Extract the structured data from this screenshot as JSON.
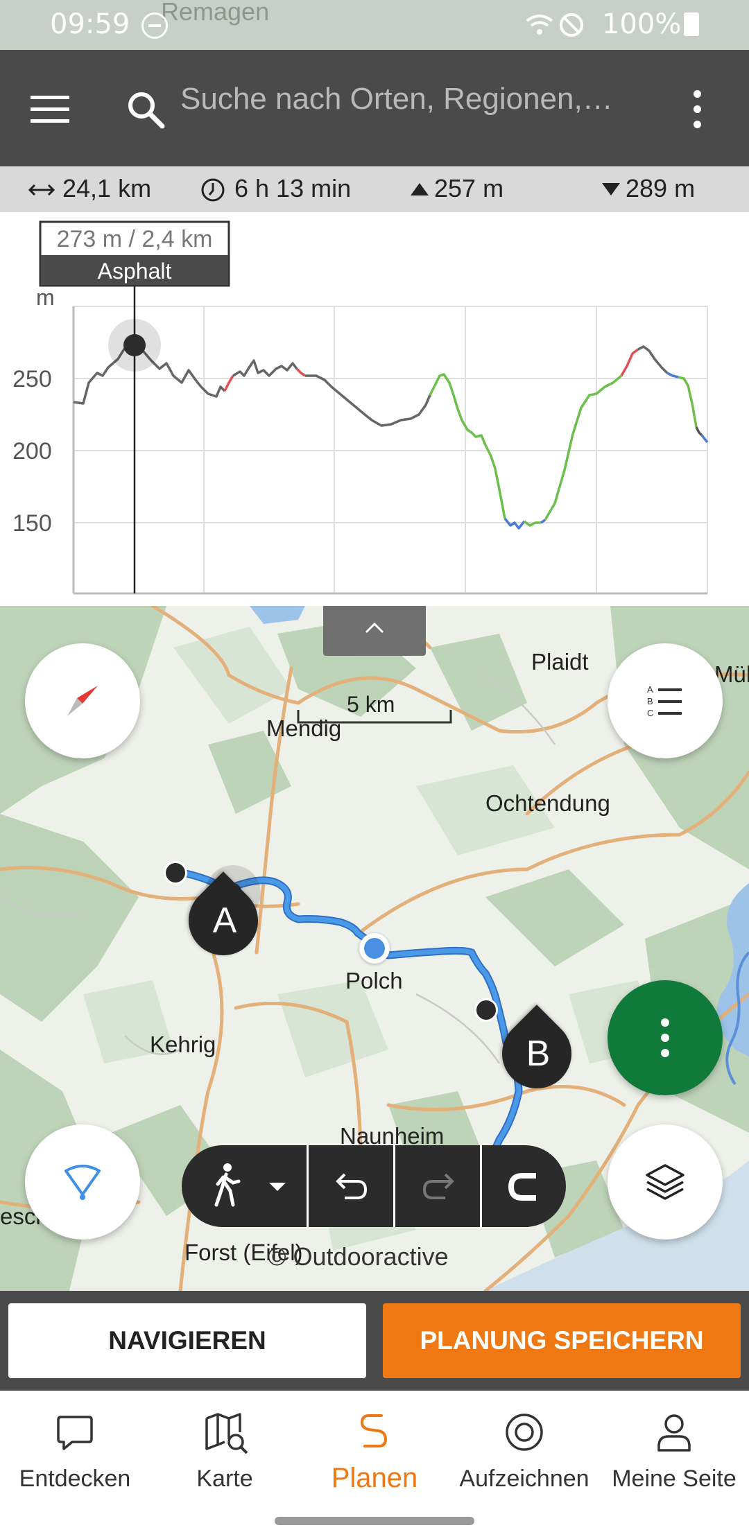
{
  "status_bar": {
    "time": "09:59",
    "battery": "100%",
    "background_town": "Remagen"
  },
  "search": {
    "placeholder": "Suche nach Orten, Regionen,…"
  },
  "stats": {
    "distance": "24,1 km",
    "duration": "6 h 13 min",
    "ascent": "257 m",
    "descent": "289 m"
  },
  "elevation_profile": {
    "tooltip_value": "273 m / 2,4 km",
    "tooltip_surface": "Asphalt",
    "y_unit": "m",
    "y_ticks": [
      "250",
      "200",
      "150"
    ]
  },
  "map": {
    "scale_label": "5 km",
    "places": {
      "mendig": "Mendig",
      "plaidt": "Plaidt",
      "muelheim": "Mülh",
      "ochtendung": "Ochtendung",
      "polch": "Polch",
      "kehrig": "Kehrig",
      "naunheim": "Naunheim",
      "forst": "Forst (Eifel)",
      "esch": "esch"
    },
    "start_marker": "A",
    "end_marker": "B",
    "attribution": "© Outdooractive",
    "route_color": "#3d8fe8"
  },
  "actions": {
    "navigate": "NAVIGIEREN",
    "save": "PLANUNG SPEICHERN"
  },
  "bottom_nav": [
    {
      "label": "Entdecken",
      "icon": "chat-bubble-icon"
    },
    {
      "label": "Karte",
      "icon": "map-search-icon"
    },
    {
      "label": "Planen",
      "icon": "route-plan-icon",
      "active": true
    },
    {
      "label": "Aufzeichnen",
      "icon": "record-icon"
    },
    {
      "label": "Meine Seite",
      "icon": "profile-icon"
    }
  ],
  "colors": {
    "accent": "#ef7812",
    "toolbar": "#4a4a4a",
    "fab_green": "#0f7a3a"
  }
}
